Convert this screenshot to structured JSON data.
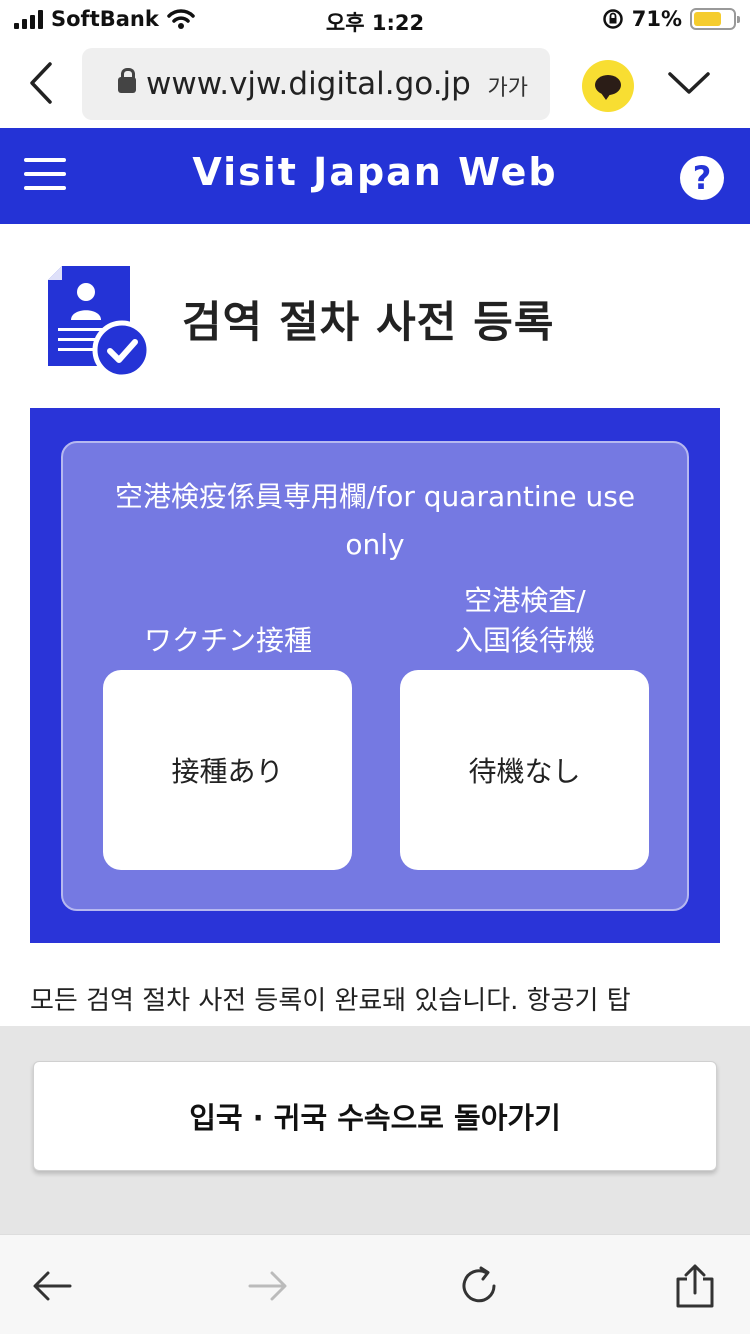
{
  "status_bar": {
    "carrier": "SoftBank",
    "time": "오후 1:22",
    "battery_percent": "71%",
    "battery_level": 0.71
  },
  "browser": {
    "url": "www.vjw.digital.go.jp",
    "font_size_label": "가가",
    "progress_color": "#f3cf45"
  },
  "header": {
    "title": "Visit Japan Web",
    "help_label": "?",
    "color": "#2433d6"
  },
  "page": {
    "title": "검역 절차 사전 등록"
  },
  "quarantine": {
    "heading": "空港検疫係員専用欄/for quarantine use only",
    "vaccine_label": "ワクチン接種",
    "vaccine_status": "接種あり",
    "testing_label_line1": "空港検査/",
    "testing_label_line2": "入国後待機",
    "testing_status": "待機なし",
    "panel_color": "#2a34d8",
    "inner_color": "#7579e2"
  },
  "notice": "모든 검역 절차 사전 등록이 완료돼 있습니다. 항공기 탑",
  "actions": {
    "return_label": "입국 · 귀국 수속으로 돌아가기"
  }
}
